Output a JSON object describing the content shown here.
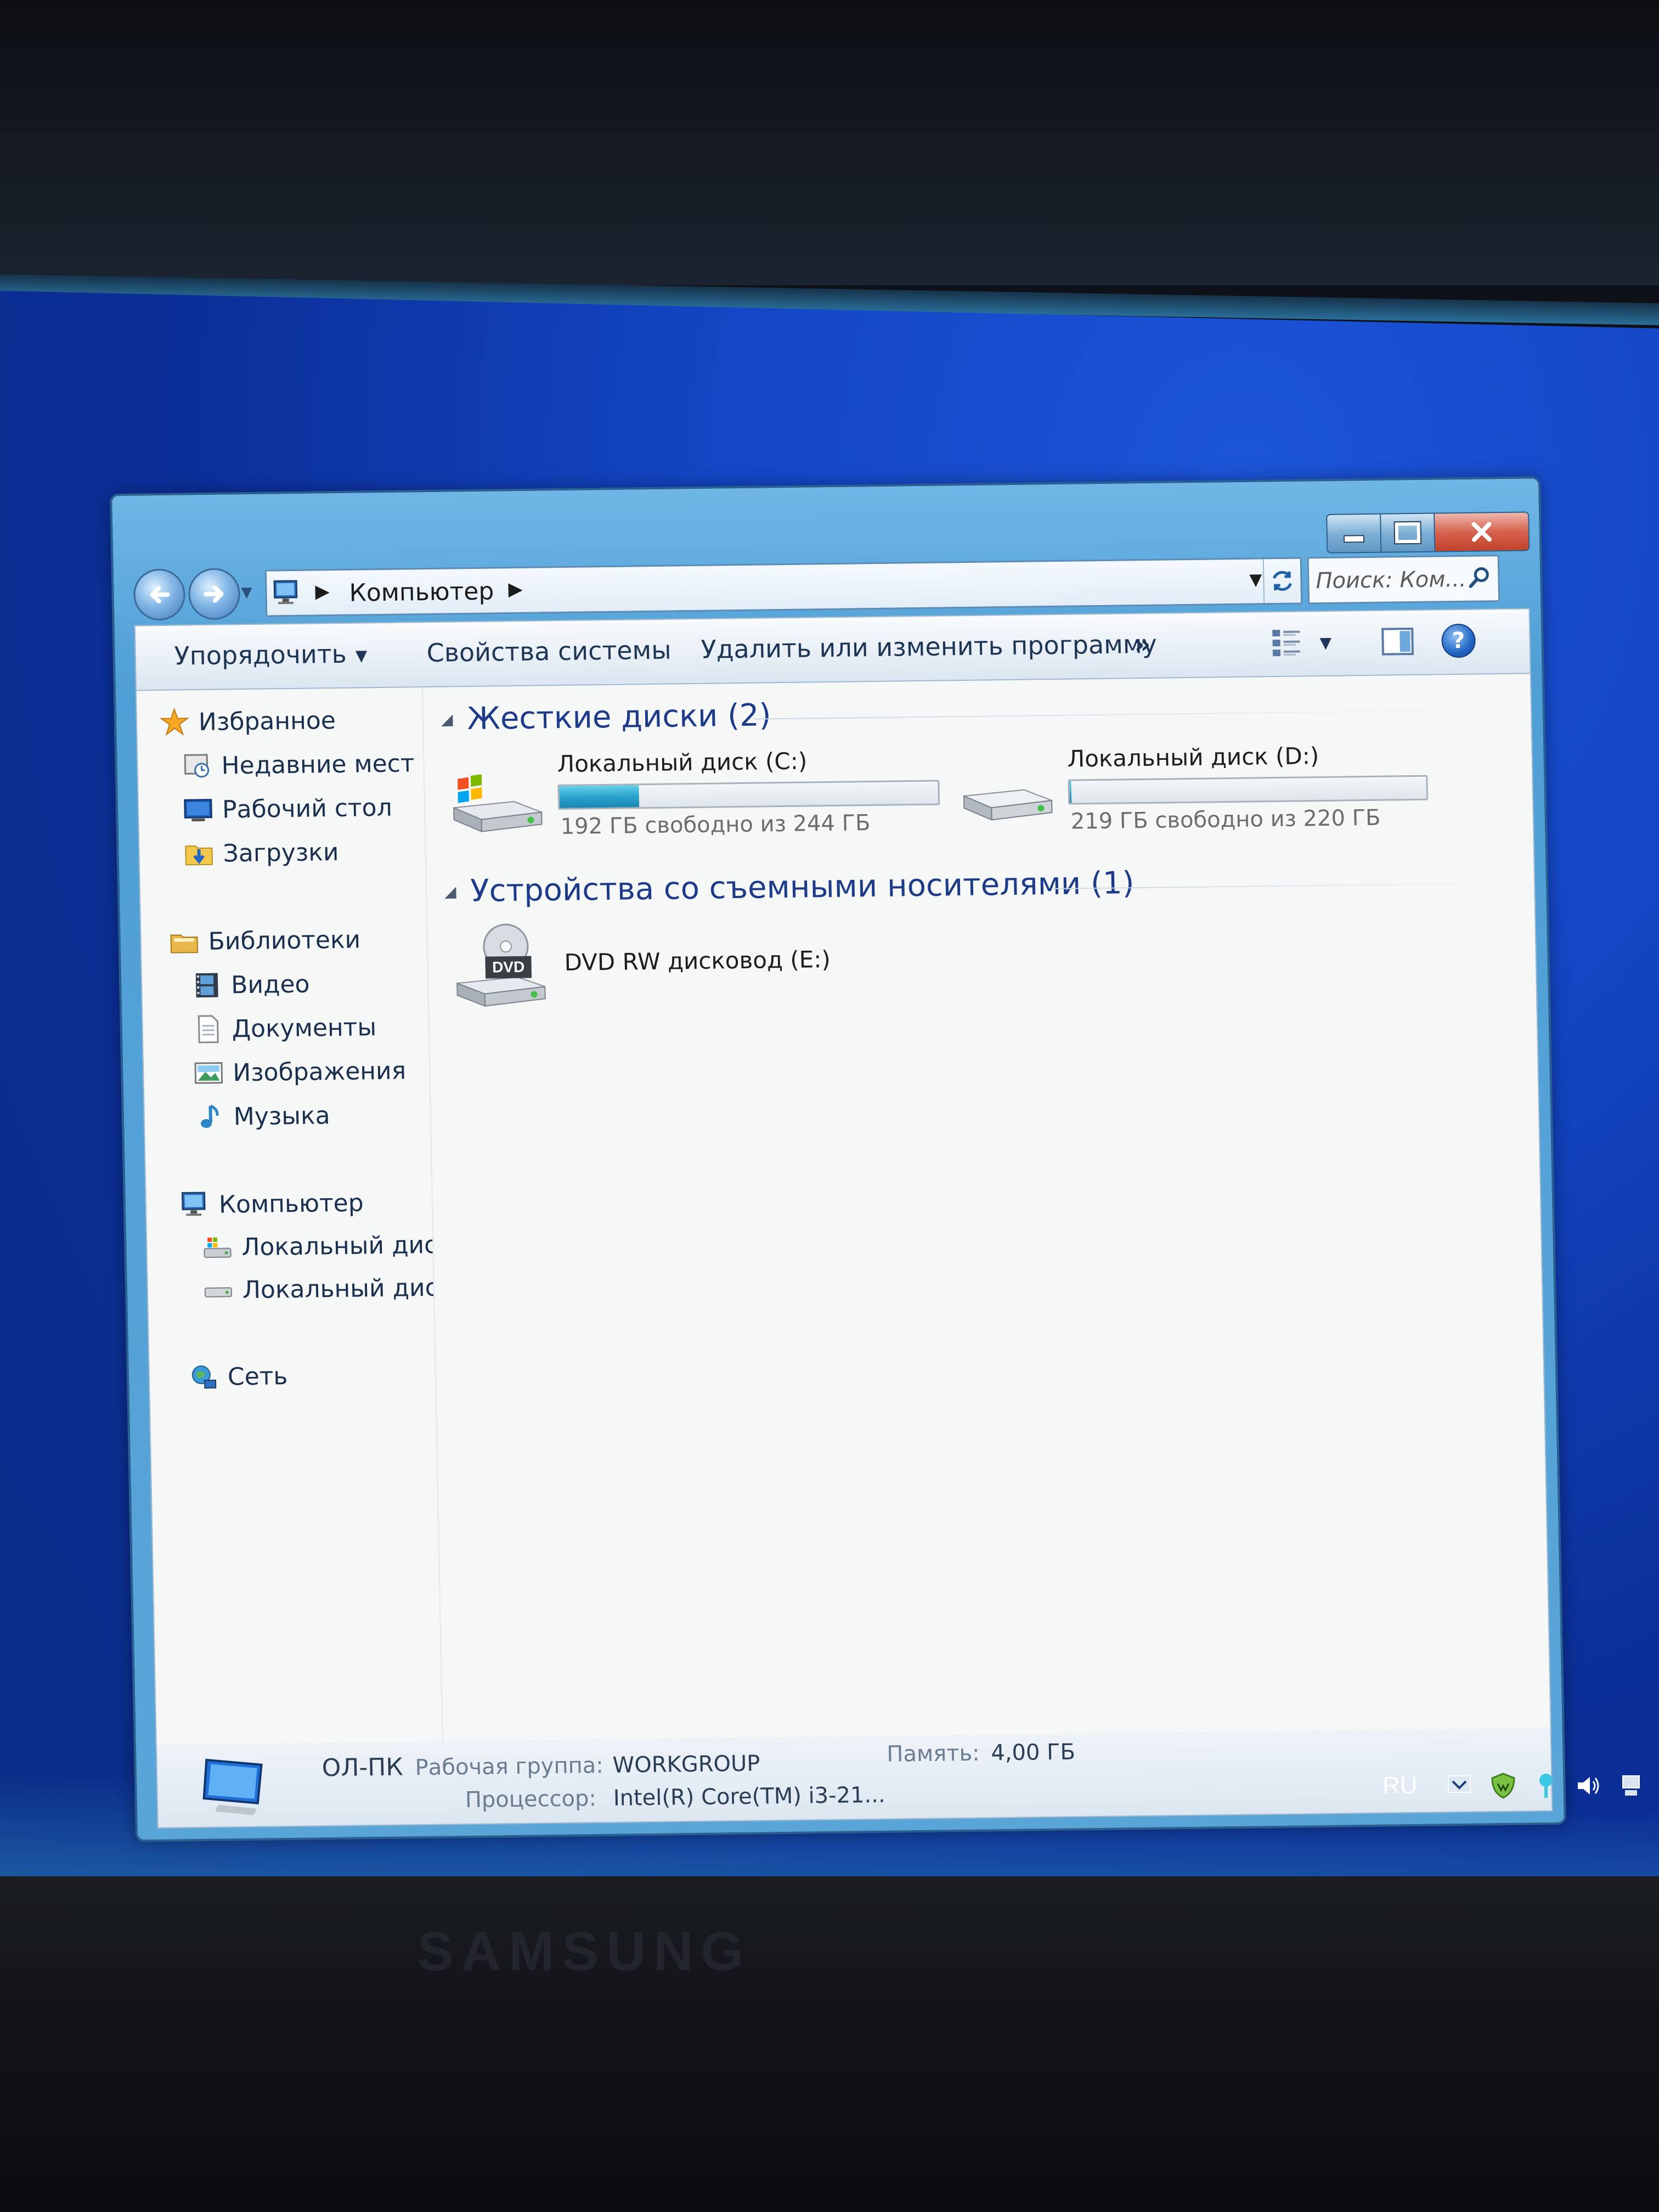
{
  "window": {
    "caption_buttons": {
      "minimize": "minimize",
      "maximize": "maximize",
      "close": "close"
    },
    "address": {
      "crumb": "Компьютер"
    },
    "search": {
      "placeholder": "Поиск: Ком..."
    },
    "command_bar": {
      "organize": "Упорядочить",
      "system_properties": "Свойства системы",
      "uninstall": "Удалить или изменить программу",
      "more": "»"
    },
    "nav": {
      "favorites": "Избранное",
      "recent": "Недавние мест",
      "desktop": "Рабочий стол",
      "downloads": "Загрузки",
      "libraries": "Библиотеки",
      "video": "Видео",
      "documents": "Документы",
      "images": "Изображения",
      "music": "Музыка",
      "computer": "Компьютер",
      "local_c": "Локальный дис",
      "local_d": "Локальный дис",
      "network": "Сеть"
    },
    "groups": {
      "hard_disks": "Жесткие диски (2)",
      "removable": "Устройства со съемными носителями (1)"
    },
    "drives": [
      {
        "name": "Локальный диск (C:)",
        "free": "192 ГБ свободно из 244 ГБ",
        "used_fraction": 0.21
      },
      {
        "name": "Локальный диск (D:)",
        "free": "219 ГБ свободно из 220 ГБ",
        "used_fraction": 0.005
      }
    ],
    "dvd": {
      "name": "DVD RW дисковод (E:)",
      "badge": "DVD"
    },
    "details": {
      "pc_name": "ОЛ-ПК",
      "workgroup_label": "Рабочая группа:",
      "workgroup": "WORKGROUP",
      "memory_label": "Память:",
      "memory": "4,00 ГБ",
      "cpu_label": "Процессор:",
      "cpu": "Intel(R) Core(TM) i3-21..."
    }
  },
  "tray": {
    "lang": "RU"
  },
  "monitor": {
    "brand": "SAMSUNG"
  },
  "colors": {
    "desktop": "#1346c4",
    "window_frame": "#5aa5d8",
    "drive_fill": "#2ba3cc",
    "group_header": "#1e3b8a"
  }
}
